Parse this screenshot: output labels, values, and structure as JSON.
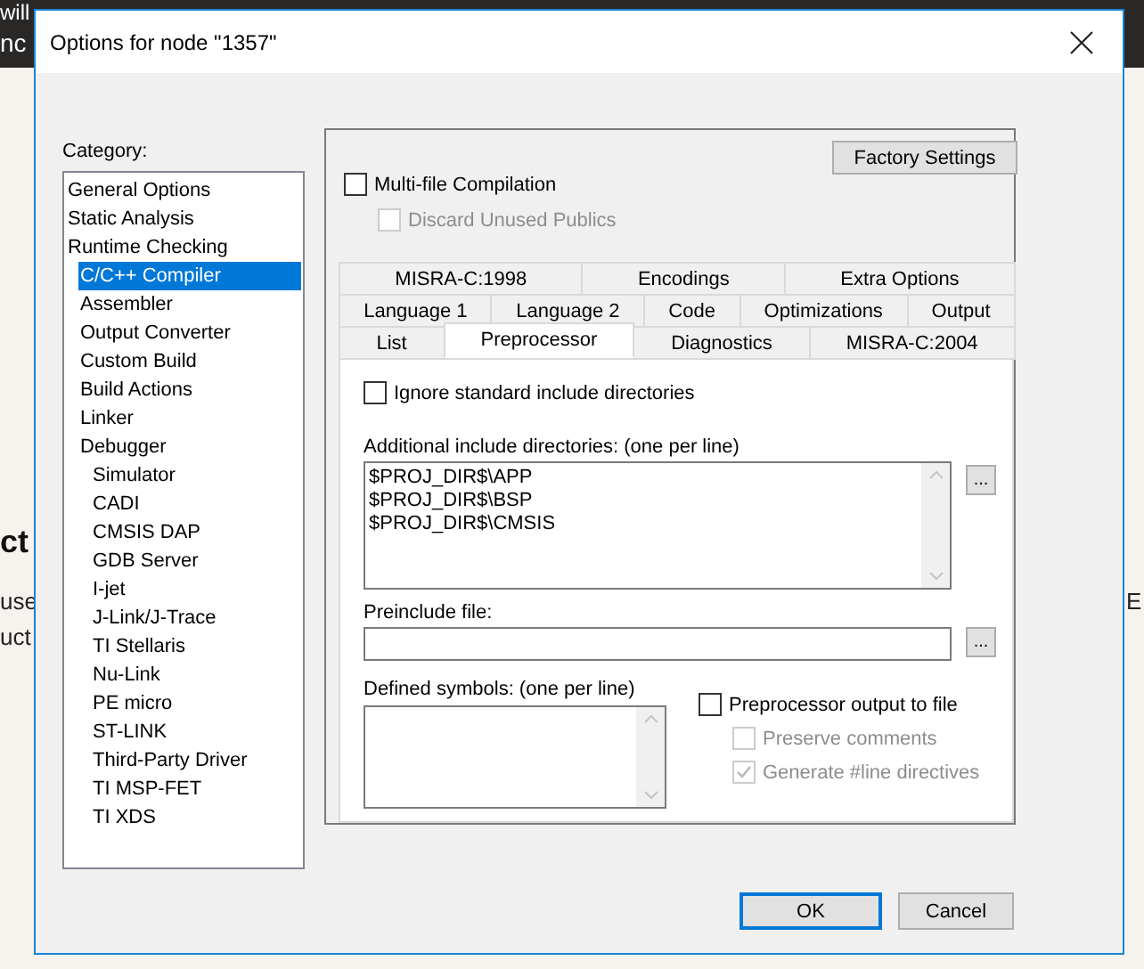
{
  "background": {
    "fragments": [
      {
        "text": "will",
        "kind": "banner"
      },
      {
        "text": "nc",
        "kind": "banner-left"
      },
      {
        "text": "ct",
        "kind": "heading"
      },
      {
        "text": "use",
        "kind": "body1"
      },
      {
        "text": "uct",
        "kind": "body2"
      },
      {
        "text": "E",
        "kind": "body-right"
      }
    ]
  },
  "window": {
    "title": "Options for node \"1357\""
  },
  "category": {
    "label": "Category:",
    "items": [
      {
        "label": "General Options",
        "selected": false
      },
      {
        "label": "Static Analysis",
        "selected": false
      },
      {
        "label": "Runtime Checking",
        "selected": false,
        "children": [
          {
            "label": "C/C++ Compiler",
            "selected": true
          },
          {
            "label": "Assembler",
            "selected": false
          },
          {
            "label": "Output Converter",
            "selected": false
          },
          {
            "label": "Custom Build",
            "selected": false
          },
          {
            "label": "Build Actions",
            "selected": false
          },
          {
            "label": "Linker",
            "selected": false
          },
          {
            "label": "Debugger",
            "selected": false,
            "children": [
              {
                "label": "Simulator",
                "selected": false
              },
              {
                "label": "CADI",
                "selected": false
              },
              {
                "label": "CMSIS DAP",
                "selected": false
              },
              {
                "label": "GDB Server",
                "selected": false
              },
              {
                "label": "I-jet",
                "selected": false
              },
              {
                "label": "J-Link/J-Trace",
                "selected": false
              },
              {
                "label": "TI Stellaris",
                "selected": false
              },
              {
                "label": "Nu-Link",
                "selected": false
              },
              {
                "label": "PE micro",
                "selected": false
              },
              {
                "label": "ST-LINK",
                "selected": false
              },
              {
                "label": "Third-Party Driver",
                "selected": false
              },
              {
                "label": "TI MSP-FET",
                "selected": false
              },
              {
                "label": "TI XDS",
                "selected": false
              }
            ]
          }
        ]
      }
    ]
  },
  "factory_settings": "Factory Settings",
  "multi_file": {
    "label": "Multi-file Compilation",
    "checked": false,
    "disabled": false,
    "children": [
      {
        "label": "Discard Unused Publics",
        "checked": false,
        "disabled": true
      }
    ]
  },
  "tab_rows": [
    [
      {
        "label": "MISRA-C:1998",
        "selected": false
      },
      {
        "label": "Encodings",
        "selected": false
      },
      {
        "label": "Extra Options",
        "selected": false
      }
    ],
    [
      {
        "label": "Language 1",
        "selected": false
      },
      {
        "label": "Language 2",
        "selected": false
      },
      {
        "label": "Code",
        "selected": false
      },
      {
        "label": "Optimizations",
        "selected": false
      },
      {
        "label": "Output",
        "selected": false
      }
    ],
    [
      {
        "label": "List",
        "selected": false
      },
      {
        "label": "Preprocessor",
        "selected": true
      },
      {
        "label": "Diagnostics",
        "selected": false
      },
      {
        "label": "MISRA-C:2004",
        "selected": false
      }
    ]
  ],
  "preprocessor": {
    "ignore_std": {
      "label": "Ignore standard include directories",
      "checked": false,
      "disabled": false
    },
    "include_dirs": {
      "label": "Additional include directories: (one per line)",
      "lines": [
        "$PROJ_DIR$\\APP",
        "$PROJ_DIR$\\BSP",
        "$PROJ_DIR$\\CMSIS"
      ],
      "browse": "..."
    },
    "preinclude": {
      "label": "Preinclude file:",
      "browse": "..."
    },
    "defined_symbols": {
      "label": "Defined symbols: (one per line)"
    },
    "output_to_file": {
      "label": "Preprocessor output to file",
      "checked": false,
      "disabled": false,
      "children": [
        {
          "label": "Preserve comments",
          "checked": false,
          "disabled": true
        },
        {
          "label": "Generate #line directives",
          "checked": true,
          "disabled": true
        }
      ]
    }
  },
  "buttons": [
    {
      "label": "OK",
      "default": true
    },
    {
      "label": "Cancel",
      "default": false
    }
  ]
}
